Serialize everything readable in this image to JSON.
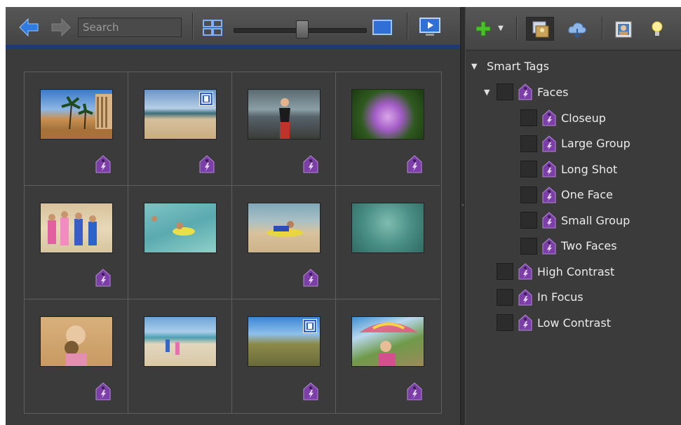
{
  "toolbar": {
    "search_placeholder": "Search",
    "icons": [
      "back-arrow-icon",
      "forward-arrow-icon",
      "grid-view-icon",
      "large-view-icon",
      "slideshow-icon"
    ]
  },
  "media_grid": {
    "thumbnails": [
      {
        "scene": "beach palms hotel",
        "video": false
      },
      {
        "scene": "beach shoreline",
        "video": true
      },
      {
        "scene": "woman on beach",
        "video": false
      },
      {
        "scene": "purple orchid",
        "video": false
      },
      {
        "scene": "kids on beach",
        "video": false
      },
      {
        "scene": "child swimming",
        "video": false
      },
      {
        "scene": "boy on boogie board",
        "video": false
      },
      {
        "scene": "underwater snorkel",
        "video": false
      },
      {
        "scene": "girl with coconut",
        "video": false
      },
      {
        "scene": "kids at shoreline",
        "video": false
      },
      {
        "scene": "kids on hillside",
        "video": true
      },
      {
        "scene": "woman with umbrella",
        "video": false
      }
    ],
    "smart_tag_shown": [
      true,
      true,
      true,
      true,
      true,
      false,
      true,
      false,
      true,
      false,
      true,
      true
    ]
  },
  "right_panel": {
    "toolbar_icons": [
      "add-tag-icon",
      "tags-panel-icon",
      "cloud-icon",
      "people-icon",
      "lightbulb-icon"
    ],
    "tree": {
      "root": "Smart Tags",
      "faces_group": "Faces",
      "faces_children": [
        "Closeup",
        "Large Group",
        "Long Shot",
        "One Face",
        "Small Group",
        "Two Faces"
      ],
      "other_items": [
        "High Contrast",
        "In Focus",
        "Low Contrast"
      ]
    }
  },
  "colors": {
    "panel_bg": "#3b3b3b",
    "accent_blue": "#2f63c6",
    "smart_tag_purple": "#7c3fa8",
    "add_green": "#49c22a"
  }
}
